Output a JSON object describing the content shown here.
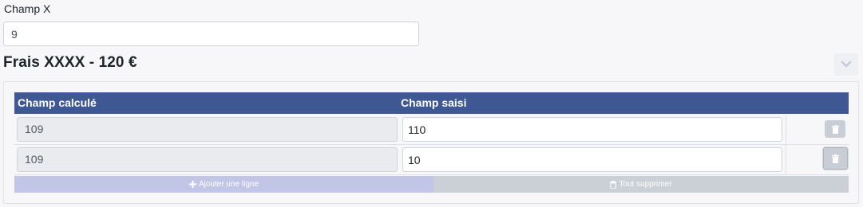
{
  "field": {
    "label": "Champ X",
    "value": "9"
  },
  "section": {
    "title": "Frais XXXX - 120 €",
    "collapse_icon": "chevron-down-icon"
  },
  "table": {
    "headers": [
      "Champ calculé",
      "Champ saisi"
    ],
    "rows": [
      {
        "computed": "109",
        "entered": "110"
      },
      {
        "computed": "109",
        "entered": "10"
      }
    ],
    "delete_icon": "trash-icon"
  },
  "actions": {
    "add_label": "Ajouter une ligne",
    "add_icon": "plus-icon",
    "clear_label": "Tout supprimer",
    "clear_icon": "trash-icon"
  },
  "colors": {
    "header_bg": "#3f5894",
    "add_bg": "#c1c5e6",
    "clear_bg": "#cbd0d7"
  }
}
